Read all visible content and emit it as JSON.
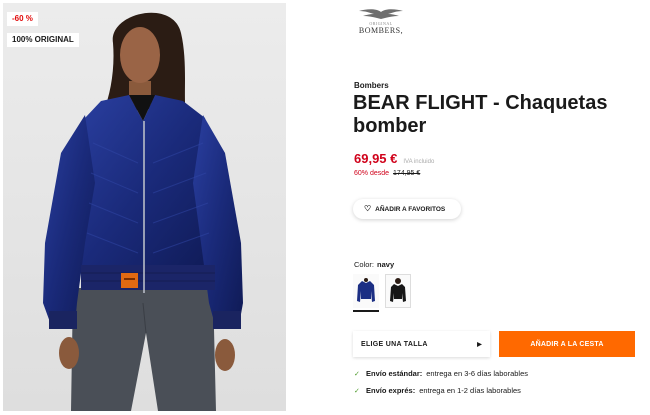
{
  "product": {
    "badges": {
      "discount": "-60 %",
      "original": "100% ORIGINAL"
    },
    "brand_logo": {
      "small_text": "ORIGINAL",
      "main_text": "BOMBERS,"
    },
    "brand": "Bombers",
    "title": "BEAR FLIGHT - Chaquetas bomber",
    "price": {
      "current": "69,95 €",
      "vat_note": "IVA incluido",
      "discount_from": "60% desde",
      "original": "174,95 €"
    },
    "favorite_label": "AÑADIR A FAVORITOS",
    "color": {
      "label": "Color:",
      "value": "navy",
      "swatches": [
        "navy",
        "black"
      ]
    },
    "size_select": {
      "label": "ELIGE UNA TALLA"
    },
    "cart_button": "AÑADIR A LA CESTA",
    "shipping": [
      {
        "label": "Envío estándar:",
        "detail": "entrega en 3-6 días laborables"
      },
      {
        "label": "Envío exprés:",
        "detail": "entrega en 1-2 días laborables"
      }
    ]
  },
  "colors": {
    "sale_red": "#d0021b",
    "cart_orange": "#ff6900",
    "check_green": "#4c9a2a",
    "jacket_navy": "#1c2f84"
  },
  "icons": {
    "heart": "heart-outline-icon",
    "caret": "triangle-right-icon",
    "check": "check-icon",
    "logo": "eagle-wings-logo"
  }
}
